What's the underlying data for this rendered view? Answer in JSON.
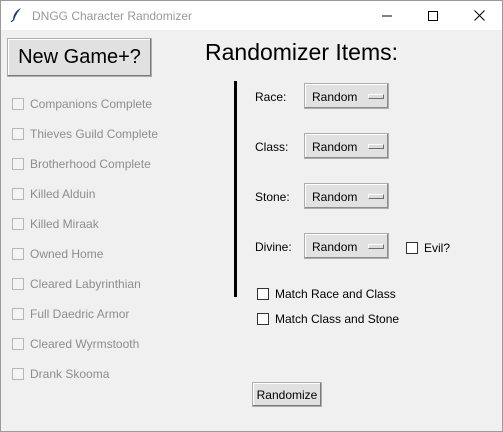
{
  "window": {
    "title": "DNGG Character Randomizer",
    "app_icon": "feather-icon",
    "controls": [
      "minimize-icon",
      "maximize-icon",
      "close-icon"
    ]
  },
  "left": {
    "new_game_label": "New Game+?",
    "checkboxes": [
      {
        "label": "Companions Complete",
        "checked": false,
        "enabled": false
      },
      {
        "label": "Thieves Guild Complete",
        "checked": false,
        "enabled": false
      },
      {
        "label": "Brotherhood Complete",
        "checked": false,
        "enabled": false
      },
      {
        "label": "Killed Alduin",
        "checked": false,
        "enabled": false
      },
      {
        "label": "Killed Miraak",
        "checked": false,
        "enabled": false
      },
      {
        "label": "Owned Home",
        "checked": false,
        "enabled": false
      },
      {
        "label": "Cleared Labyrinthian",
        "checked": false,
        "enabled": false
      },
      {
        "label": "Full Daedric Armor",
        "checked": false,
        "enabled": false
      },
      {
        "label": "Cleared Wyrmstooth",
        "checked": false,
        "enabled": false
      },
      {
        "label": "Drank Skooma",
        "checked": false,
        "enabled": false
      }
    ]
  },
  "right": {
    "heading": "Randomizer Items:",
    "fields": [
      {
        "label": "Race:",
        "value": "Random"
      },
      {
        "label": "Class:",
        "value": "Random"
      },
      {
        "label": "Stone:",
        "value": "Random"
      },
      {
        "label": "Divine:",
        "value": "Random"
      }
    ],
    "evil_label": "Evil?",
    "match_race_class_label": "Match Race and Class",
    "match_class_stone_label": "Match Class and Stone",
    "randomize_label": "Randomize"
  },
  "colors": {
    "background": "#f0f0f0",
    "titlebar": "#ffffff",
    "disabled_text": "#8d8d8d",
    "button_face": "#e1e1e1"
  }
}
